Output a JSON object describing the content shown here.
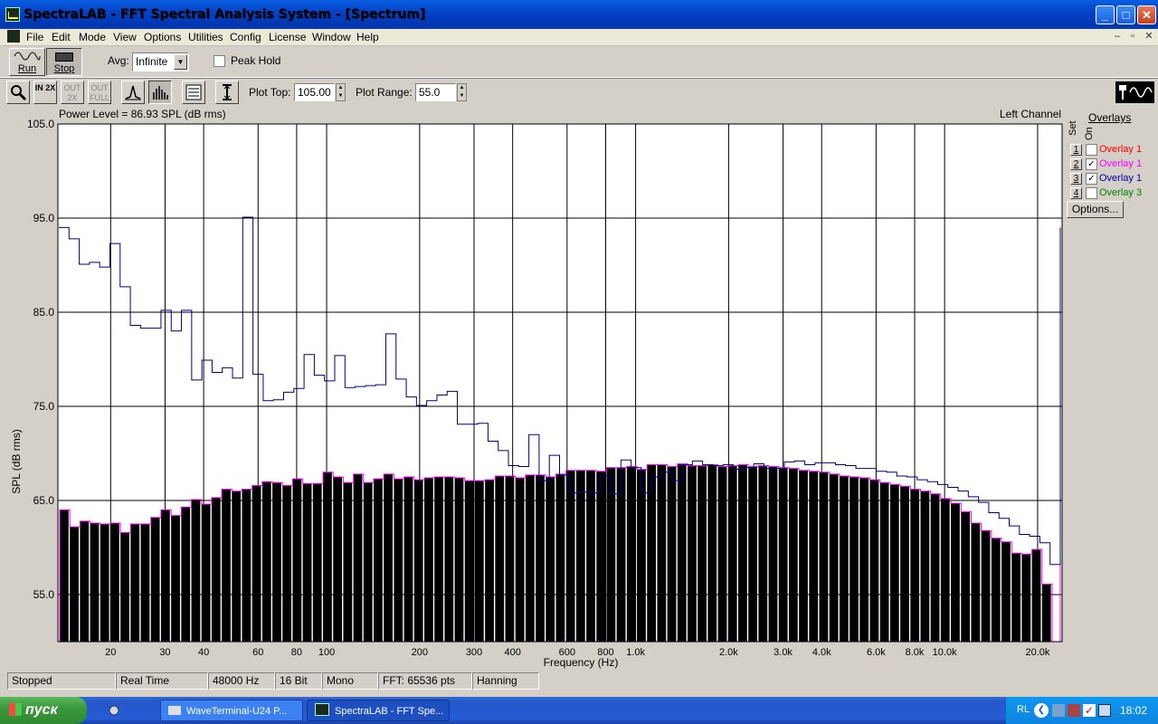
{
  "window": {
    "title": "SpectraLAB - FFT Spectral Analysis System - [Spectrum]",
    "minimize": "_",
    "maximize": "□",
    "close": "✕"
  },
  "menu": [
    "File",
    "Edit",
    "Mode",
    "View",
    "Options",
    "Utilities",
    "Config",
    "License",
    "Window",
    "Help"
  ],
  "mdi_controls": [
    "–",
    "▫",
    "✕"
  ],
  "toolbar": {
    "run_label": "Run",
    "stop_label": "Stop",
    "avg_label": "Avg:",
    "avg_value": "Infinite",
    "peak_hold_label": "Peak Hold",
    "peak_hold_checked": false,
    "plot_top_label": "Plot Top:",
    "plot_top_value": "105.00",
    "plot_range_label": "Plot Range:",
    "plot_range_value": "55.0",
    "tool_icons": [
      "zoom-icon",
      "zoom-in-2x-icon",
      "zoom-out-2x-icon",
      "zoom-out-full-icon",
      "line-plot-icon",
      "bar-plot-icon",
      "settings-panel-icon",
      "scale-icon",
      "spectralab-logo-icon"
    ],
    "zoom_in_text": "IN 2X",
    "zoom_out_text": "OUT 2X",
    "zoom_full_text": "OUT FULL"
  },
  "plot": {
    "power_level": "Power Level = 86.93 SPL (dB rms)",
    "channel": "Left Channel",
    "y_axis_label": "SPL (dB rms)",
    "x_axis_label": "Frequency (Hz)",
    "y_ticks": [
      "105.0",
      "95.0",
      "85.0",
      "75.0",
      "65.0",
      "55.0"
    ],
    "x_ticks": [
      "20",
      "30",
      "40",
      "60",
      "80",
      "100",
      "200",
      "300",
      "400",
      "600",
      "800",
      "1.0k",
      "2.0k",
      "3.0k",
      "4.0k",
      "6.0k",
      "8.0k",
      "10.0k",
      "20.0k"
    ]
  },
  "overlays": {
    "header": "Overlays",
    "col_set": "Set",
    "col_on": "On",
    "items": [
      {
        "num": "1",
        "label": "Overlay 1",
        "checked": false,
        "color": "#ff0000"
      },
      {
        "num": "2",
        "label": "Overlay 1",
        "checked": true,
        "color": "#ff00ff"
      },
      {
        "num": "3",
        "label": "Overlay 1",
        "checked": true,
        "color": "#0000a0"
      },
      {
        "num": "4",
        "label": "Overlay 3",
        "checked": false,
        "color": "#008000"
      }
    ],
    "options_label": "Options..."
  },
  "chart_data": {
    "type": "bar",
    "xscale": "log",
    "xlim": [
      13.5,
      24000
    ],
    "ylim": [
      50,
      105
    ],
    "xlabel": "Frequency (Hz)",
    "ylabel": "SPL (dB rms)",
    "grid": true,
    "bar_color": "#000000",
    "bar_outline_color": "#ff00ff",
    "line_color": "#000080",
    "bars": [
      64,
      62.2,
      62.8,
      62.6,
      62.5,
      62.6,
      61.6,
      62.5,
      62.5,
      63.2,
      64,
      63.4,
      64.3,
      65.1,
      64.6,
      65.3,
      66.2,
      66,
      66.2,
      66.6,
      67,
      66.9,
      66.6,
      67.3,
      66.8,
      66.8,
      68,
      67.5,
      66.9,
      67.8,
      66.9,
      67.3,
      67.8,
      67.3,
      67.5,
      67.2,
      67.4,
      67.5,
      67.5,
      67.4,
      67.1,
      67.1,
      67.2,
      67.6,
      67.6,
      67.4,
      67.7,
      67.7,
      67.5,
      67.8,
      68.2,
      68.2,
      68.2,
      68.1,
      68.5,
      68.5,
      68.6,
      68.3,
      68.8,
      68.8,
      68.6,
      68.9,
      68.7,
      68.7,
      68.8,
      68.6,
      68.7,
      68.8,
      68.6,
      68.7,
      68.6,
      68.5,
      68.4,
      68.2,
      68.1,
      68,
      67.8,
      67.6,
      67.5,
      67.4,
      67.2,
      66.9,
      66.7,
      66.5,
      66.2,
      66,
      65.7,
      65.2,
      64.7,
      63.8,
      62.6,
      61.8,
      61,
      60.6,
      59.4,
      59.3,
      59.8,
      56.1
    ],
    "overlay_line": [
      94,
      92.8,
      90.1,
      90.3,
      89.8,
      92.3,
      87.7,
      83.6,
      83.3,
      83.3,
      85.2,
      83,
      85.2,
      77.8,
      79.9,
      78.6,
      79.1,
      78,
      95.1,
      78.4,
      75.6,
      75.7,
      76.5,
      76.9,
      80.5,
      78.3,
      77.7,
      80.4,
      77,
      77.1,
      77.2,
      77.3,
      82.7,
      77.9,
      76,
      75.1,
      75.6,
      76.2,
      76.6,
      73.1,
      73.1,
      73.2,
      71.3,
      70.3,
      68.7,
      68.6,
      72,
      67.1,
      69.8,
      67.7,
      65.8,
      65.9,
      65.8,
      67.6,
      65.7,
      69.3,
      68.5,
      65.8,
      67.5,
      68,
      67.1,
      68.8,
      69.2,
      68.8,
      68.7,
      68.8,
      68.3,
      68.5,
      68.9,
      68.4,
      68.4,
      69.1,
      69.2,
      68.8,
      69,
      69,
      68.8,
      68.7,
      68.4,
      68.4,
      68.1,
      68,
      67.6,
      67.5,
      67.2,
      67,
      66.7,
      66.4,
      66,
      65.4,
      64.8,
      63.7,
      63.1,
      62.3,
      61.4,
      61.2,
      60.5,
      58.2
    ],
    "final_spike": 94
  },
  "status": [
    "Stopped",
    "Real Time",
    "48000 Hz",
    "16 Bit",
    "Mono",
    "FFT: 65536 pts",
    "Hanning"
  ],
  "taskbar": {
    "start_label": "пуск",
    "tasks": [
      "WaveTerminal-U24 P...",
      "SpectraLAB - FFT Spe..."
    ],
    "tray_lang": "RL",
    "clock": "18:02"
  }
}
